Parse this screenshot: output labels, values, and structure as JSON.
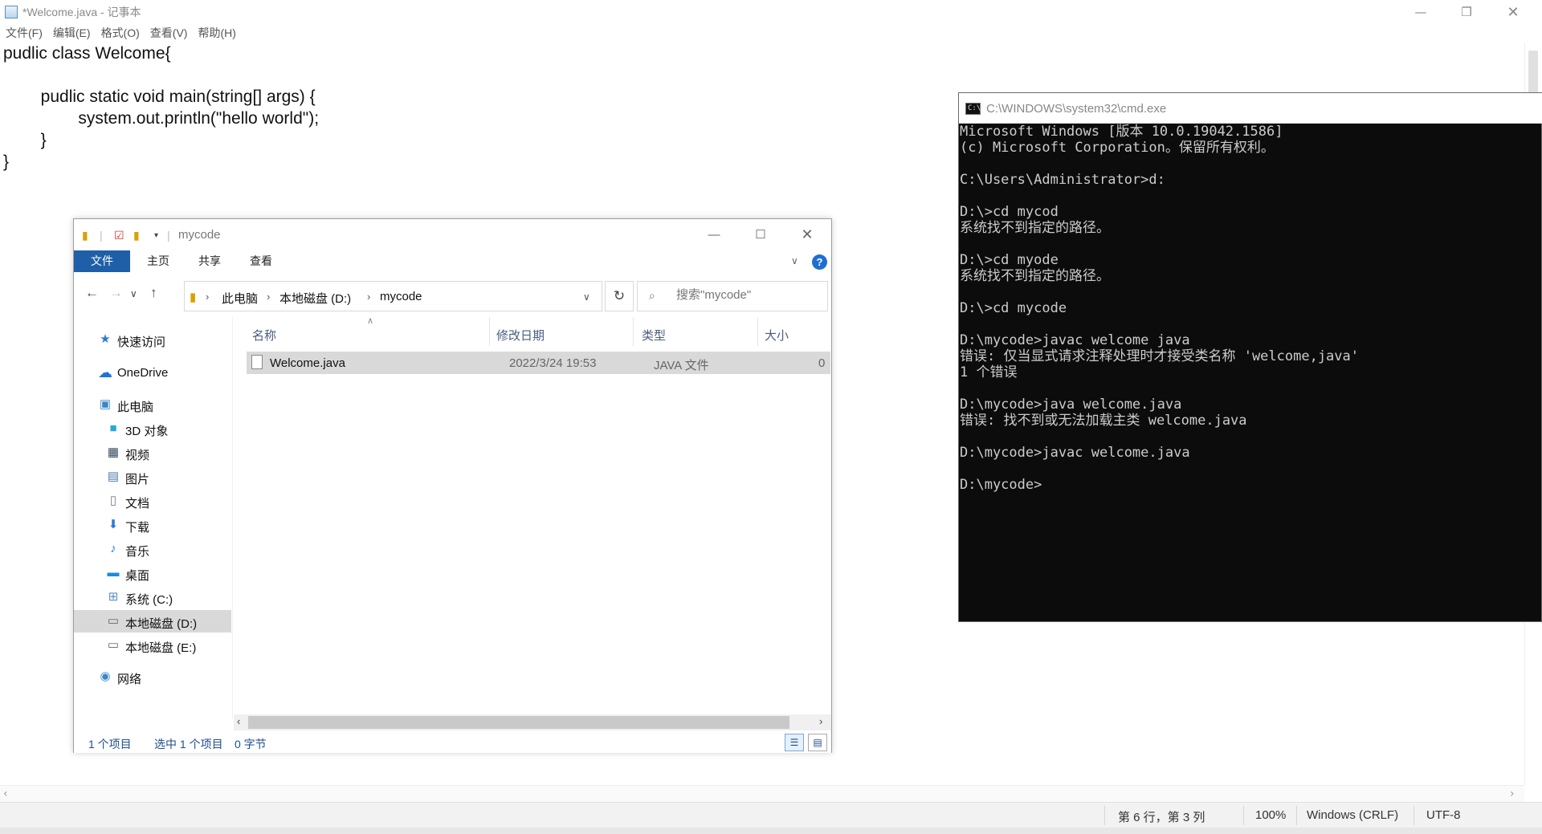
{
  "notepad": {
    "title": "*Welcome.java - 记事本",
    "menu": [
      "文件(F)",
      "编辑(E)",
      "格式(O)",
      "查看(V)",
      "帮助(H)"
    ],
    "code_lines": [
      "pudlic class Welcome{",
      "",
      "        pudlic static void main(string[] args) {",
      "                system.out.println(\"hello world\");",
      "        }",
      "}"
    ],
    "status": {
      "position": "第 6 行，第 3 列",
      "zoom": "100%",
      "line_ending": "Windows (CRLF)",
      "encoding": "UTF-8"
    }
  },
  "explorer": {
    "title": "mycode",
    "ribbon_tabs": [
      "文件",
      "主页",
      "共享",
      "查看"
    ],
    "breadcrumb": [
      "此电脑",
      "本地磁盘 (D:)",
      "mycode"
    ],
    "search_placeholder": "搜索\"mycode\"",
    "sidebar": [
      {
        "label": "快速访问",
        "icon": "star-icon"
      },
      {
        "label": "OneDrive",
        "icon": "cloud-icon"
      },
      {
        "label": "此电脑",
        "icon": "computer-icon"
      },
      {
        "label": "3D 对象",
        "icon": "cube-icon"
      },
      {
        "label": "视频",
        "icon": "film-icon"
      },
      {
        "label": "图片",
        "icon": "picture-icon"
      },
      {
        "label": "文档",
        "icon": "document-icon"
      },
      {
        "label": "下载",
        "icon": "download-icon"
      },
      {
        "label": "音乐",
        "icon": "music-icon"
      },
      {
        "label": "桌面",
        "icon": "desktop-icon"
      },
      {
        "label": "系统 (C:)",
        "icon": "system-drive-icon"
      },
      {
        "label": "本地磁盘 (D:)",
        "icon": "drive-icon"
      },
      {
        "label": "本地磁盘 (E:)",
        "icon": "drive-icon"
      },
      {
        "label": "网络",
        "icon": "network-icon"
      }
    ],
    "columns": [
      "名称",
      "修改日期",
      "类型",
      "大小"
    ],
    "files": [
      {
        "name": "Welcome.java",
        "modified": "2022/3/24 19:53",
        "type": "JAVA 文件",
        "size": "0"
      }
    ],
    "status": {
      "count": "1 个项目",
      "selected": "选中 1 个项目",
      "size": "0 字节"
    }
  },
  "cmd": {
    "title": "C:\\WINDOWS\\system32\\cmd.exe",
    "lines": [
      "Microsoft Windows [版本 10.0.19042.1586]",
      "(c) Microsoft Corporation。保留所有权利。",
      "",
      "C:\\Users\\Administrator>d:",
      "",
      "D:\\>cd mycod",
      "系统找不到指定的路径。",
      "",
      "D:\\>cd myode",
      "系统找不到指定的路径。",
      "",
      "D:\\>cd mycode",
      "",
      "D:\\mycode>javac welcome java",
      "错误: 仅当显式请求注释处理时才接受类名称 'welcome,java'",
      "1 个错误",
      "",
      "D:\\mycode>java welcome.java",
      "错误: 找不到或无法加载主类 welcome.java",
      "",
      "D:\\mycode>javac welcome.java",
      "",
      "D:\\mycode>"
    ]
  }
}
